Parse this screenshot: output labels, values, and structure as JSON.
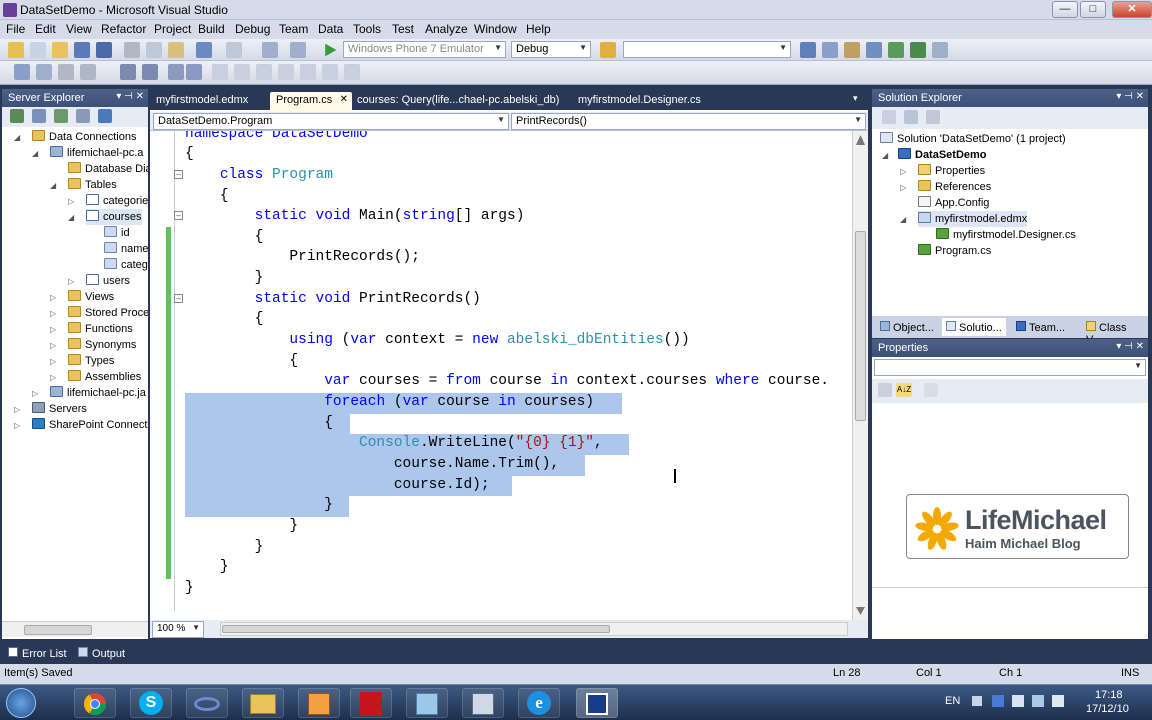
{
  "window": {
    "title": "DataSetDemo - Microsoft Visual Studio",
    "minimize": "—",
    "maximize": "□",
    "close": "✕"
  },
  "menu": [
    "File",
    "Edit",
    "View",
    "Refactor",
    "Project",
    "Build",
    "Debug",
    "Team",
    "Data",
    "Tools",
    "Test",
    "Analyze",
    "Window",
    "Help"
  ],
  "toolbar": {
    "platform": "Windows Phone 7 Emulator",
    "config": "Debug",
    "find": ""
  },
  "server_explorer": {
    "title": "Server Explorer",
    "pin": "▾ ⊣ ✕",
    "items": [
      {
        "label": "Data Connections"
      },
      {
        "label": "lifemichael-pc.a"
      },
      {
        "label": "Database Dia"
      },
      {
        "label": "Tables"
      },
      {
        "label": "categorie"
      },
      {
        "label": "courses"
      },
      {
        "label": "id"
      },
      {
        "label": "name"
      },
      {
        "label": "categ"
      },
      {
        "label": "users"
      },
      {
        "label": "Views"
      },
      {
        "label": "Stored Proce"
      },
      {
        "label": "Functions"
      },
      {
        "label": "Synonyms"
      },
      {
        "label": "Types"
      },
      {
        "label": "Assemblies"
      },
      {
        "label": "lifemichael-pc.ja"
      },
      {
        "label": "Servers"
      },
      {
        "label": "SharePoint Connect"
      }
    ]
  },
  "doc_tabs": [
    {
      "label": "myfirstmodel.edmx"
    },
    {
      "label": "Program.cs"
    },
    {
      "label": "courses: Query(life...chael-pc.abelski_db)"
    },
    {
      "label": "myfirstmodel.Designer.cs"
    }
  ],
  "tab_close": "✕",
  "tab_overflow": "▾",
  "nav": {
    "left": "DataSetDemo.Program",
    "right": "PrintRecords()"
  },
  "code": {
    "l0": "namespace DataSetDemo",
    "l1": "{",
    "l2_kw": "class",
    "l2_ty": "Program",
    "l3": "{",
    "l4_kw": "static void",
    "l4_rest": " Main(",
    "l4_kw2": "string",
    "l4_rest2": "[] args)",
    "l5": "{",
    "l6": "PrintRecords();",
    "l7": "}",
    "l8_kw": "static void",
    "l8_rest": " PrintRecords()",
    "l9": "{",
    "l10_kw": "using",
    "l10_a": " (",
    "l10_kw2": "var",
    "l10_b": " context = ",
    "l10_kw3": "new",
    "l10_ty": "abelski_dbEntities",
    "l10_c": "())",
    "l11": "{",
    "l12_kw": "var",
    "l12_a": " courses = ",
    "l12_kw2": "from",
    "l12_b": " course ",
    "l12_kw3": "in",
    "l12_c": " context.courses ",
    "l12_kw4": "where",
    "l12_d": " course.",
    "l13_kw": "foreach",
    "l13_a": " (",
    "l13_kw2": "var",
    "l13_b": " course ",
    "l13_kw3": "in",
    "l13_c": " courses)",
    "l14": "{",
    "l15_ty": "Console",
    "l15_a": ".WriteLine(",
    "l15_st": "\"{0} {1}\"",
    "l15_b": ",",
    "l16": "course.Name.Trim(),",
    "l17": "course.Id);",
    "l18": "}",
    "l19": "}",
    "l20": "}",
    "l21": "}",
    "l22": "}"
  },
  "fold_symbol": "–",
  "zoom": "100 %",
  "solution_explorer": {
    "title": "Solution Explorer",
    "pin": "▾ ⊣ ✕",
    "items": [
      {
        "label": "Solution 'DataSetDemo' (1 project)"
      },
      {
        "label": "DataSetDemo"
      },
      {
        "label": "Properties"
      },
      {
        "label": "References"
      },
      {
        "label": "App.Config"
      },
      {
        "label": "myfirstmodel.edmx"
      },
      {
        "label": "myfirstmodel.Designer.cs"
      },
      {
        "label": "Program.cs"
      }
    ]
  },
  "tool_tabs": [
    "Object...",
    "Solutio...",
    "Team...",
    "Class V..."
  ],
  "properties": {
    "title": "Properties",
    "pin": "▾ ⊣ ✕",
    "sort_icon": "A↓Z"
  },
  "logo": {
    "name": "LifeMichael",
    "tagline": "Haim Michael Blog"
  },
  "output_tabs": [
    "Error List",
    "Output"
  ],
  "status": {
    "message": "Item(s) Saved",
    "ln": "Ln 28",
    "col": "Col 1",
    "ch": "Ch 1",
    "mode": "INS"
  },
  "taskbar": {
    "lang": "EN",
    "time": "17:18",
    "date": "17/12/10"
  },
  "colors": {
    "keyword": "#0000ff",
    "type": "#2b91af",
    "string": "#a31515",
    "selection": "#adc6ec",
    "panel_header": "#3c5078",
    "vs_frame": "#293955"
  }
}
